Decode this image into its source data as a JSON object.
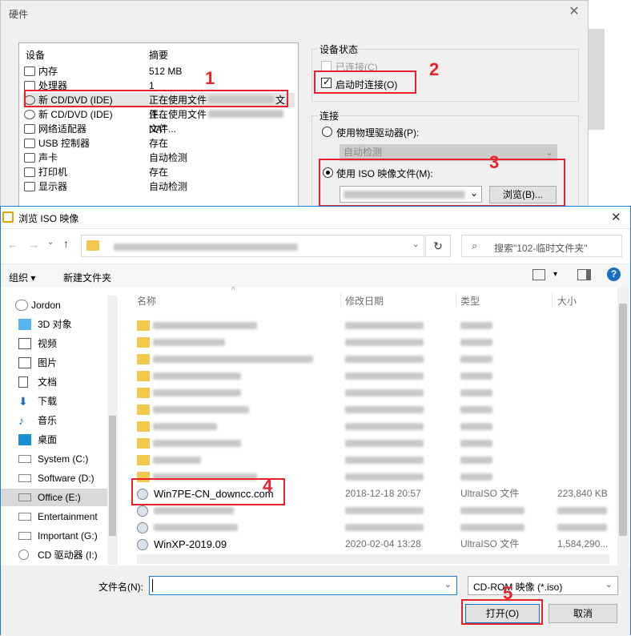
{
  "hw": {
    "title": "硬件",
    "close": "✕",
    "list_header_device": "设备",
    "list_header_summary": "摘要",
    "devices": [
      {
        "name": "内存",
        "summary": "512 MB"
      },
      {
        "name": "处理器",
        "summary": "1"
      },
      {
        "name": "新 CD/DVD (IDE)",
        "summary": "正在使用文件",
        "summary_tail": "文件..."
      },
      {
        "name": "新 CD/DVD (IDE)",
        "summary": "正在使用文件",
        "summary_tail": "文件..."
      },
      {
        "name": "网络适配器",
        "summary": "NAT"
      },
      {
        "name": "USB 控制器",
        "summary": "存在"
      },
      {
        "name": "声卡",
        "summary": "自动检测"
      },
      {
        "name": "打印机",
        "summary": "存在"
      },
      {
        "name": "显示器",
        "summary": "自动检测"
      }
    ],
    "device_status_title": "设备状态",
    "connected_label": "已连接(C)",
    "connect_on_start_label": "启动时连接(O)",
    "connection_title": "连接",
    "physical_drive_label": "使用物理驱动器(P):",
    "physical_drive_value": "自动检测",
    "iso_label": "使用 ISO 映像文件(M):",
    "browse_label": "浏览(B)..."
  },
  "fd": {
    "title": "浏览 ISO 映像",
    "close": "✕",
    "search_placeholder": "搜索\"102-临时文件夹\"",
    "organize": "组织 ▾",
    "new_folder": "新建文件夹",
    "col_name": "名称",
    "col_date": "修改日期",
    "col_type": "类型",
    "col_size": "大小",
    "sidebar": [
      {
        "label": "Jordon",
        "icon": "user-icon"
      },
      {
        "label": "3D 对象",
        "icon": "cube-icon"
      },
      {
        "label": "视频",
        "icon": "video-icon"
      },
      {
        "label": "图片",
        "icon": "picture-icon"
      },
      {
        "label": "文档",
        "icon": "document-icon"
      },
      {
        "label": "下载",
        "icon": "download-icon"
      },
      {
        "label": "音乐",
        "icon": "music-icon"
      },
      {
        "label": "桌面",
        "icon": "desktop-icon"
      },
      {
        "label": "System (C:)",
        "icon": "drive-icon"
      },
      {
        "label": "Software (D:)",
        "icon": "drive-icon"
      },
      {
        "label": "Office (E:)",
        "icon": "drive-icon"
      },
      {
        "label": "Entertainment",
        "icon": "drive-icon"
      },
      {
        "label": "Important (G:)",
        "icon": "drive-icon"
      },
      {
        "label": "CD 驱动器 (I:)",
        "icon": "cd-drive-icon"
      }
    ],
    "files": [
      {
        "name": "Win7PE-CN_downcc.com",
        "date": "2018-12-18 20:57",
        "type": "UltraISO 文件",
        "size": "223,840 KB"
      },
      {
        "name": "WinXP-2019.09",
        "date": "2020-02-04 13:28",
        "type": "UltraISO 文件",
        "size": "1,584,290..."
      }
    ],
    "filename_label": "文件名(N):",
    "filetype_value": "CD-ROM 映像 (*.iso)",
    "open_label": "打开(O)",
    "cancel_label": "取消"
  },
  "markers": [
    "1",
    "2",
    "3",
    "4",
    "5"
  ],
  "colors": {
    "accent": "#1a7bcf",
    "marker": "#e8222d",
    "selected": "#cce8ff"
  }
}
